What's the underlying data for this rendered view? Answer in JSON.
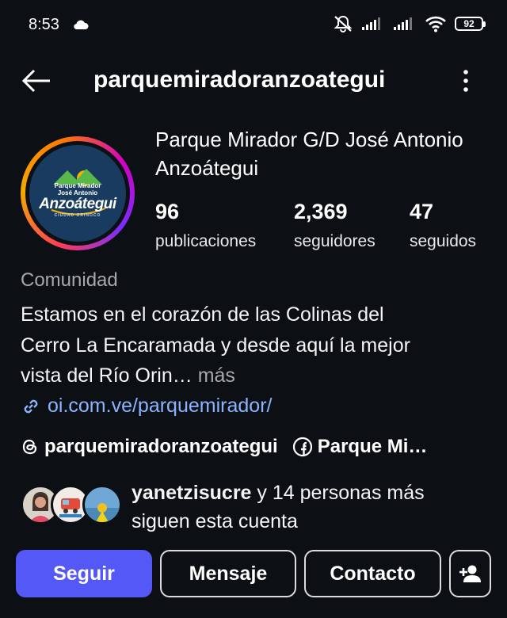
{
  "status_bar": {
    "time": "8:53",
    "battery": "92"
  },
  "header": {
    "username": "parquemiradoranzoategui"
  },
  "profile": {
    "full_name": "Parque Mirador G/D José Antonio Anzoátegui",
    "avatar_logo": {
      "line1": "Parque Mirador",
      "line2": "José Antonio",
      "big": "Anzoátegui",
      "sub": "CIUDAD ORINOCO"
    },
    "stats": [
      {
        "value": "96",
        "label": "publicaciones"
      },
      {
        "value": "2,369",
        "label": "seguidores"
      },
      {
        "value": "47",
        "label": "seguidos"
      }
    ],
    "category": "Comunidad",
    "bio_line1": "Estamos en el corazón de las Colinas del",
    "bio_line2": "Cerro La Encaramada y desde aquí la mejor",
    "bio_line3": "vista del Río Orin…",
    "bio_more": " más",
    "link": "oi.com.ve/parquemirador/"
  },
  "social": {
    "threads_handle": "parquemiradoranzoategui",
    "facebook_name": "Parque Mi…"
  },
  "followed_by": {
    "name": "yanetzisucre",
    "rest_line1": " y 14 personas más",
    "line2": "siguen esta cuenta"
  },
  "actions": {
    "follow": "Seguir",
    "message": "Mensaje",
    "contact": "Contacto"
  },
  "colors": {
    "background": "#0c1014",
    "primary_button": "#5458f7",
    "link": "#8ab4ff"
  }
}
